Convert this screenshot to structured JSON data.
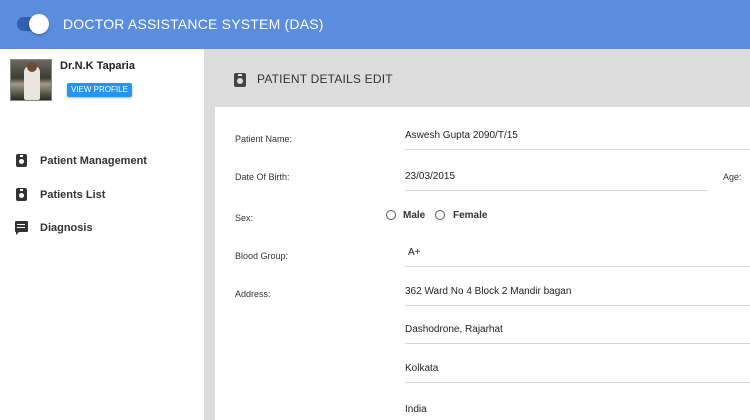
{
  "app": {
    "title": "DOCTOR ASSISTANCE SYSTEM (DAS)"
  },
  "header": {
    "menu_toggle_state": "on"
  },
  "sidebar": {
    "doctor_name": "Dr.N.K Taparia",
    "view_profile_label": "VIEW PROFILE",
    "items": [
      {
        "label": "Patient Management",
        "icon": "assignment-ind-icon"
      },
      {
        "label": "Patients List",
        "icon": "assignment-ind-icon"
      },
      {
        "label": "Diagnosis",
        "icon": "chat-icon"
      }
    ]
  },
  "main": {
    "section_title": "PATIENT DETAILS EDIT",
    "section_icon": "assignment-ind-icon",
    "form": {
      "patient_name_label": "Patient Name:",
      "patient_name_value": "Aswesh Gupta 2090/T/15",
      "dob_label": "Date Of Birth:",
      "dob_value": "23/03/2015",
      "age_label": "Age:",
      "sex_label": "Sex:",
      "sex_options": [
        "Male",
        "Female"
      ],
      "sex_selected": "",
      "blood_group_label": "Blood Group:",
      "blood_group_value": "A+",
      "address_label": "Address:",
      "address_lines": [
        "362 Ward No 4 Block 2 Mandir bagan",
        "Dashodrone, Rajarhat",
        "Kolkata",
        "India"
      ]
    }
  },
  "colors": {
    "header_bg": "#5b8ddf",
    "button_bg": "#2196f3",
    "content_bg": "#dcdcdc"
  }
}
